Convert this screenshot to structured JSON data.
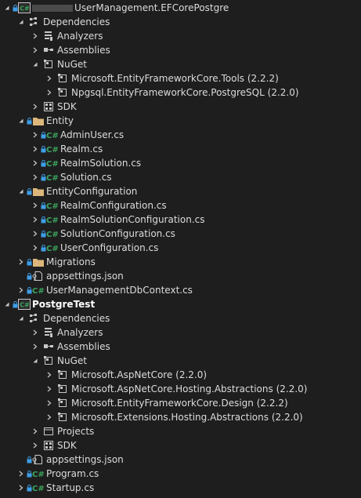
{
  "solution_explorer": {
    "project1": {
      "name_suffix": "UserManagement.EFCorePostgre",
      "dependencies": "Dependencies",
      "analyzers": "Analyzers",
      "assemblies": "Assemblies",
      "nuget": "NuGet",
      "packages": [
        {
          "name": "Microsoft.EntityFrameworkCore.Tools",
          "version": "(2.2.2)"
        },
        {
          "name": "Npgsql.EntityFrameworkCore.PostgreSQL",
          "version": "(2.2.0)"
        }
      ],
      "sdk": "SDK",
      "entity_folder": "Entity",
      "entity_files": [
        "AdminUser.cs",
        "Realm.cs",
        "RealmSolution.cs",
        "Solution.cs"
      ],
      "entity_config_folder": "EntityConfiguration",
      "entity_config_files": [
        "RealmConfiguration.cs",
        "RealmSolutionConfiguration.cs",
        "SolutionConfiguration.cs",
        "UserConfiguration.cs"
      ],
      "migrations_folder": "Migrations",
      "appsettings": "appsettings.json",
      "dbcontext": "UserManagementDbContext.cs"
    },
    "project2": {
      "name": "PostgreTest",
      "dependencies": "Dependencies",
      "analyzers": "Analyzers",
      "assemblies": "Assemblies",
      "nuget": "NuGet",
      "packages": [
        {
          "name": "Microsoft.AspNetCore",
          "version": "(2.2.0)"
        },
        {
          "name": "Microsoft.AspNetCore.Hosting.Abstractions",
          "version": "(2.2.0)"
        },
        {
          "name": "Microsoft.EntityFrameworkCore.Design",
          "version": "(2.2.2)"
        },
        {
          "name": "Microsoft.Extensions.Hosting.Abstractions",
          "version": "(2.2.0)"
        }
      ],
      "projects": "Projects",
      "sdk": "SDK",
      "appsettings": "appsettings.json",
      "program": "Program.cs",
      "startup": "Startup.cs"
    },
    "icons": {
      "csharp_project": "csharp-project-icon",
      "dependencies": "dependencies-icon",
      "analyzers": "analyzers-icon",
      "assemblies": "assemblies-icon",
      "nuget": "nuget-icon",
      "package": "package-icon",
      "sdk": "sdk-icon",
      "folder": "folder-icon",
      "csharp_file": "csharp-file-icon",
      "json_file": "json-file-icon",
      "projects": "projects-icon",
      "lock": "lock-icon",
      "chevron_right": "chevron-right-icon",
      "chevron_down": "chevron-down-icon"
    },
    "colors": {
      "background": "#1e1e1e",
      "text": "#dcdcdc",
      "csharp_green": "#3ba55d",
      "folder_gold": "#dcb67a",
      "lock_blue": "#3e9ee8",
      "chevron": "#c8c8c8"
    }
  }
}
